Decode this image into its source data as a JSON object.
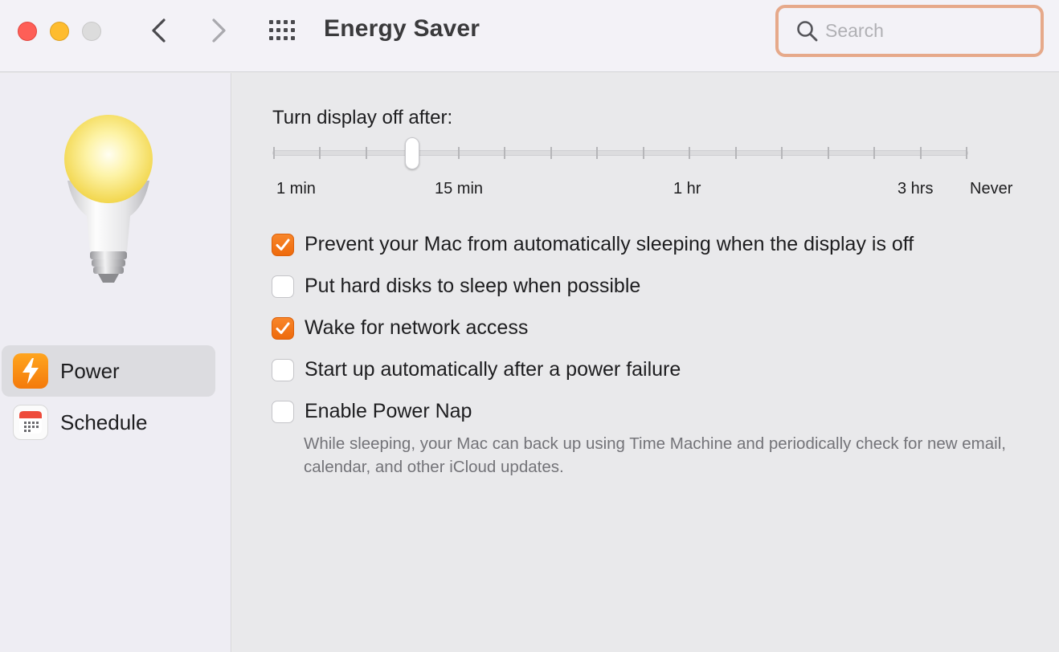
{
  "window": {
    "title": "Energy Saver"
  },
  "search": {
    "placeholder": "Search",
    "value": ""
  },
  "sidebar": {
    "items": [
      {
        "label": "Power",
        "icon": "power-bolt-icon",
        "selected": true
      },
      {
        "label": "Schedule",
        "icon": "calendar-icon",
        "selected": false
      }
    ]
  },
  "display_slider": {
    "title": "Turn display off after:",
    "labels": [
      "1 min",
      "15 min",
      "1 hr",
      "3 hrs",
      "Never"
    ],
    "selected_value": "15 min",
    "tick_count": 16
  },
  "options": [
    {
      "label": "Prevent your Mac from automatically sleeping when the display is off",
      "checked": true
    },
    {
      "label": "Put hard disks to sleep when possible",
      "checked": false
    },
    {
      "label": "Wake for network access",
      "checked": true
    },
    {
      "label": "Start up automatically after a power failure",
      "checked": false
    },
    {
      "label": "Enable Power Nap",
      "checked": false
    }
  ],
  "power_nap_description": "While sleeping, your Mac can back up using Time Machine and periodically check for new email, calendar, and other iCloud updates.",
  "colors": {
    "accent": "#f07a1a",
    "search_focus_ring": "#e6a98a",
    "close": "#fe5f57",
    "minimize": "#febc2e"
  }
}
